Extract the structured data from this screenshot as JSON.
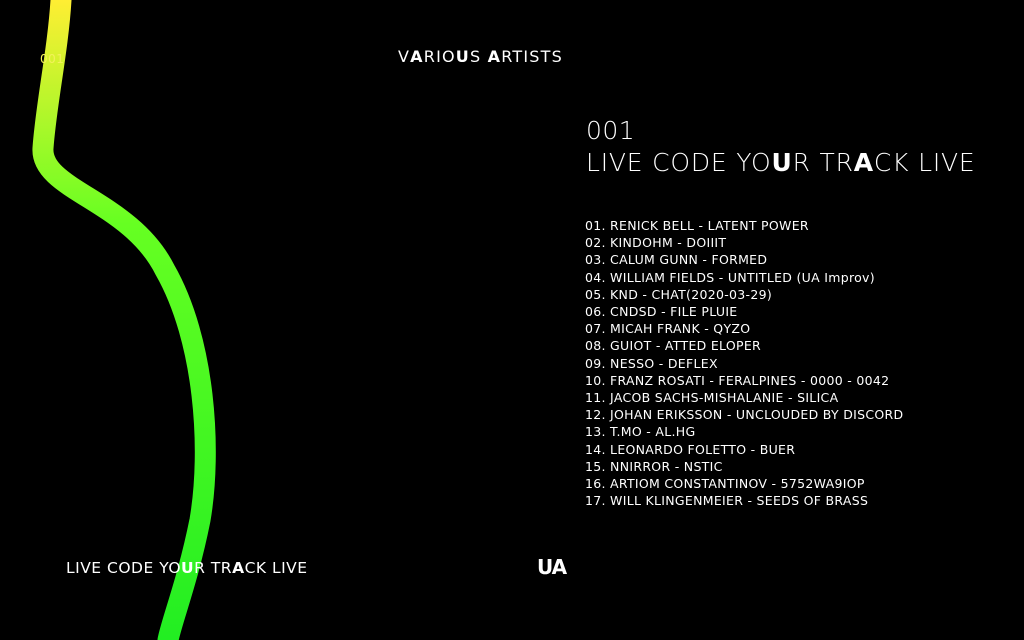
{
  "cover": {
    "catalog_small": "001",
    "artist_header": [
      {
        "text": "V",
        "bold": false
      },
      {
        "text": "A",
        "bold": true
      },
      {
        "text": "RIO",
        "bold": false
      },
      {
        "text": "U",
        "bold": true
      },
      {
        "text": "S ",
        "bold": false
      },
      {
        "text": "A",
        "bold": true
      },
      {
        "text": "RTISTS",
        "bold": false
      }
    ],
    "catalog_number": "001",
    "title_segments": [
      {
        "text": "LIVE CODE YO",
        "bold": false
      },
      {
        "text": "U",
        "bold": true
      },
      {
        "text": "R TR",
        "bold": false
      },
      {
        "text": "A",
        "bold": true
      },
      {
        "text": "CK LIVE",
        "bold": false
      }
    ],
    "bottom_title_segments": [
      {
        "text": "LIVE CODE YO",
        "bold": false
      },
      {
        "text": "U",
        "bold": true
      },
      {
        "text": "R TR",
        "bold": false
      },
      {
        "text": "A",
        "bold": true
      },
      {
        "text": "CK LIVE",
        "bold": false
      }
    ],
    "logo": "UA",
    "tracks": [
      "01. RENICK BELL - LATENT POWER",
      "02. KINDOHM - DOIIIT",
      "03. CALUM GUNN - FORMED",
      "04. WILLIAM FIELDS - UNTITLED (UA Improv)",
      "05. KND - CHAT(2020-03-29)",
      "06. CNDSD - FILE PLUIE",
      "07. MICAH FRANK - QYZO",
      "08. GUIOT - ATTED ELOPER",
      "09. NESSO - DEFLEX",
      "10. FRANZ ROSATI - FERALPINES - 0000 - 0042",
      "11. JACOB SACHS-MISHALANIE - SILICA",
      "12. JOHAN ERIKSSON - UNCLOUDED BY DISCORD",
      "13. T.MO - AL.HG",
      "14. LEONARDO FOLETTO - BUER",
      "15. NNIRROR - NSTIC",
      "16. ARTIOM CONSTANTINOV - 5752WA9IOP",
      "17. WILL KLINGENMEIER - SEEDS OF BRASS"
    ]
  },
  "colors": {
    "background": "#000000",
    "text": "#ffffff",
    "curve_top": "#ffee33",
    "curve_mid": "#66ff22",
    "curve_bottom": "#22ee22"
  }
}
